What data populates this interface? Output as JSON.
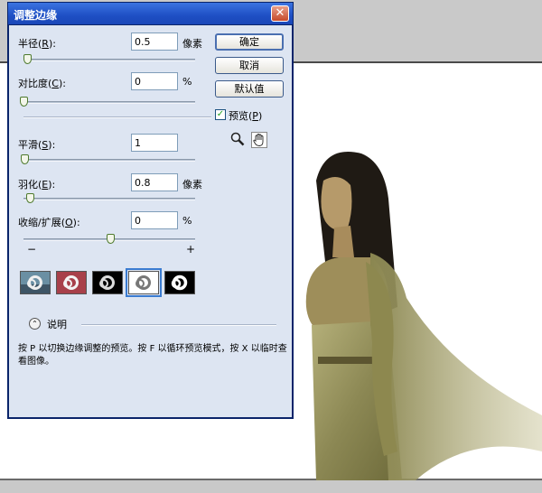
{
  "dialog": {
    "title": "调整边缘",
    "close_glyph": "✕"
  },
  "params": {
    "radius": {
      "label_prefix": "半径(",
      "key": "R",
      "label_suffix": "):",
      "value": "0.5",
      "unit": "像素",
      "slider": 0.05
    },
    "contrast": {
      "label_prefix": "对比度(",
      "key": "C",
      "label_suffix": "):",
      "value": "0",
      "unit": "%",
      "slider": 0.0
    },
    "smooth": {
      "label_prefix": "平滑(",
      "key": "S",
      "label_suffix": "):",
      "value": "1",
      "slider": 0.01
    },
    "feather": {
      "label_prefix": "羽化(",
      "key": "E",
      "label_suffix": "):",
      "value": "0.8",
      "unit": "像素",
      "slider": 0.04
    },
    "contract": {
      "label_prefix": "收缩/扩展(",
      "key": "O",
      "label_suffix": "):",
      "value": "0",
      "unit": "%",
      "slider": 0.5,
      "minus": "−",
      "plus": "+"
    }
  },
  "buttons": {
    "ok": "确定",
    "cancel": "取消",
    "default": "默认值"
  },
  "preview": {
    "checked": true,
    "label_prefix": "预览(",
    "key": "P",
    "label_suffix": ")"
  },
  "tools": [
    "zoom-icon",
    "hand-icon"
  ],
  "view_modes": [
    {
      "name": "standard-mode",
      "selected": false
    },
    {
      "name": "quick-mask-mode",
      "selected": false
    },
    {
      "name": "on-black-mode",
      "selected": false
    },
    {
      "name": "on-white-mode",
      "selected": true
    },
    {
      "name": "mask-mode",
      "selected": false
    }
  ],
  "description": {
    "toggle_glyph": "⌃",
    "label": "说明",
    "text": "按 P 以切换边缘调整的预览。按 F 以循环预览模式，按 X 以临时查看图像。"
  },
  "colors": {
    "titlebar": "#1e4fc4",
    "dialog_bg": "#dde5f2",
    "slider_thumb": "#4e7a2e"
  }
}
